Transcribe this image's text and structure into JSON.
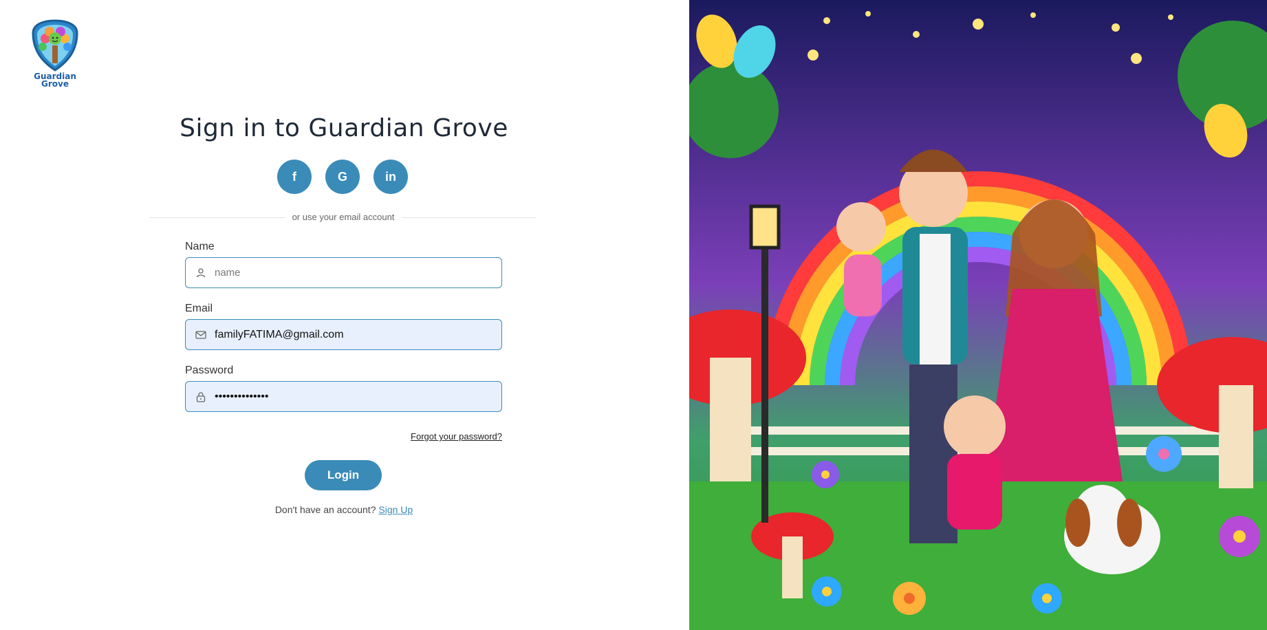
{
  "brand": {
    "logo_line1": "Guardian",
    "logo_line2": "Grove"
  },
  "title": "Sign in to Guardian Grove",
  "social": [
    {
      "label": "f",
      "icon": "facebook-icon"
    },
    {
      "label": "G",
      "icon": "google-icon"
    },
    {
      "label": "in",
      "icon": "linkedin-icon"
    }
  ],
  "divider_text": "or use your email account",
  "form": {
    "name_label": "Name",
    "name_placeholder": "name",
    "name_value": "",
    "email_label": "Email",
    "email_value": "familyFATIMA@gmail.com",
    "password_label": "Password",
    "password_value": "••••••••••••••"
  },
  "forgot_text": "Forgot your password?",
  "login_label": "Login",
  "signup_prompt": "Don't have an account?",
  "signup_link": "Sign Up",
  "colors": {
    "accent": "#3a8bb8",
    "field_fill": "#e8f0fd"
  }
}
